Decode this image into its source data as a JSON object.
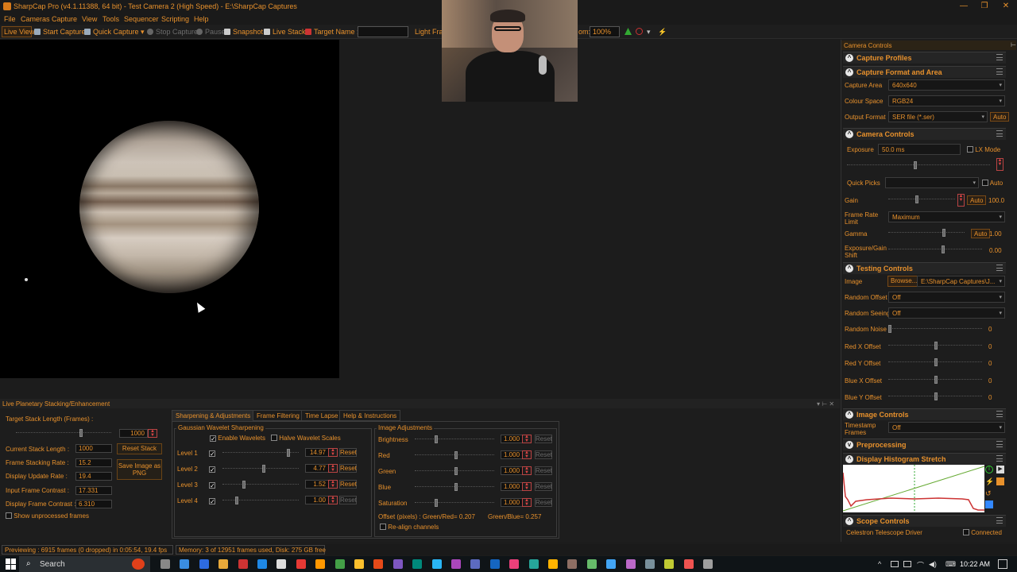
{
  "window": {
    "title": "SharpCap Pro (v4.1.11388, 64 bit) - Test Camera 2 (High Speed) - E:\\SharpCap Captures",
    "min": "—",
    "max": "❐",
    "close": "✕"
  },
  "menu": [
    "File",
    "Cameras",
    "Capture",
    "View",
    "Tools",
    "Sequencer",
    "Scripting",
    "Help"
  ],
  "toolbar": {
    "live_view": "Live View",
    "start_capture": "Start Capture",
    "quick_capture": "Quick Capture",
    "stop_capture": "Stop Capture",
    "pause": "Pause",
    "snapshot": "Snapshot",
    "live_stack": "Live Stack",
    "target_name": "Target Name :",
    "target_value": "",
    "light_frames": "Light Fram",
    "zoom_label": "om:",
    "zoom_value": "100%"
  },
  "right": {
    "title": "Camera Controls",
    "capture_profiles": "Capture Profiles",
    "format_area": "Capture Format and Area",
    "capture_area_label": "Capture Area",
    "capture_area": "640x640",
    "colour_space_label": "Colour Space",
    "colour_space": "RGB24",
    "output_format_label": "Output Format",
    "output_format": "SER file (*.ser)",
    "auto": "Auto",
    "camera_controls": "Camera Controls",
    "exposure_label": "Exposure",
    "exposure": "50.0 ms",
    "lx_mode": "LX Mode",
    "quick_picks_label": "Quick Picks",
    "quick_picks_auto": "Auto",
    "gain_label": "Gain",
    "gain_value": "100.0",
    "gain_level": 0.44,
    "frame_rate_label": "Frame Rate Limit",
    "frame_rate": "Maximum",
    "gamma_label": "Gamma",
    "gamma_value": "1.00",
    "gamma_level": 0.75,
    "exposure_gain_label": "Exposure/Gain Shift",
    "exposure_gain_value": "0.00",
    "exposure_gain_level": 0.6,
    "testing_controls": "Testing Controls",
    "image_label": "Image",
    "browse": "Browse...",
    "image_path": "E:\\SharpCap Captures\\J...",
    "random_offset_label": "Random Offset",
    "random_offset": "Off",
    "random_seeing_label": "Random Seeing",
    "random_seeing": "Off",
    "random_noise_label": "Random Noise",
    "random_noise": "0",
    "red_x_label": "Red X Offset",
    "red_x": "0",
    "red_y_label": "Red Y Offset",
    "red_y": "0",
    "blue_x_label": "Blue X Offset",
    "blue_x": "0",
    "blue_y_label": "Blue Y Offset",
    "blue_y": "0",
    "image_controls": "Image Controls",
    "timestamp_label": "Timestamp Frames",
    "timestamp": "Off",
    "preprocessing": "Preprocessing",
    "histogram": "Display Histogram Stretch",
    "scope_controls": "Scope Controls",
    "scope_driver": "Celestron Telescope Driver",
    "connected": "Connected"
  },
  "stack": {
    "title": "Live Planetary Stacking/Enhancement",
    "target_length_label": "Target Stack Length (Frames) :",
    "target_length": "1000",
    "current_length_label": "Current Stack Length :",
    "current_length": "1000",
    "reset_stack": "Reset Stack",
    "stacking_rate_label": "Frame Stacking Rate :",
    "stacking_rate": "15.2",
    "display_rate_label": "Display Update Rate :",
    "display_rate": "19.4",
    "save_png": "Save Image as PNG",
    "input_contrast_label": "Input Frame Contrast :",
    "input_contrast": "17.331",
    "display_contrast_label": "Display Frame Contrast :",
    "display_contrast": "6.310",
    "show_unprocessed": "Show unprocessed frames",
    "tabs": [
      "Sharpening & Adjustments",
      "Frame Filtering",
      "Time Lapse",
      "Help & Instructions"
    ],
    "wavelet_group": "Gaussian Wavelet Sharpening",
    "enable_wavelets": "Enable Wavelets",
    "halve_scales": "Halve Wavelet Scales",
    "levels": [
      {
        "label": "Level 1",
        "value": "14.97",
        "pos": 0.9
      },
      {
        "label": "Level 2",
        "value": "4.77",
        "pos": 0.55
      },
      {
        "label": "Level 3",
        "value": "1.52",
        "pos": 0.28
      },
      {
        "label": "Level 4",
        "value": "1.00",
        "pos": 0.18
      }
    ],
    "reset": "Reset",
    "adj_group": "Image Adjustments",
    "adjustments": [
      {
        "label": "Brightness",
        "value": "1.000",
        "pos": 0.25
      },
      {
        "label": "Red",
        "value": "1.000",
        "pos": 0.5
      },
      {
        "label": "Green",
        "value": "1.000",
        "pos": 0.5
      },
      {
        "label": "Blue",
        "value": "1.000",
        "pos": 0.5
      },
      {
        "label": "Saturation",
        "value": "1.000",
        "pos": 0.25
      }
    ],
    "offset_text": "Offset (pixels) : Green/Red=",
    "offset_gr": "0.207",
    "offset_gb_label": "Green/Blue=",
    "offset_gb": "0.257",
    "realign": "Re-align channels"
  },
  "status": {
    "preview": "Previewing : 6915 frames (0 dropped) in 0:05:54, 19.4 fps",
    "memory": "Memory: 3 of 12951 frames used, Disk: 275 GB free"
  },
  "taskbar": {
    "search": "Search",
    "time": "10:22 AM"
  }
}
